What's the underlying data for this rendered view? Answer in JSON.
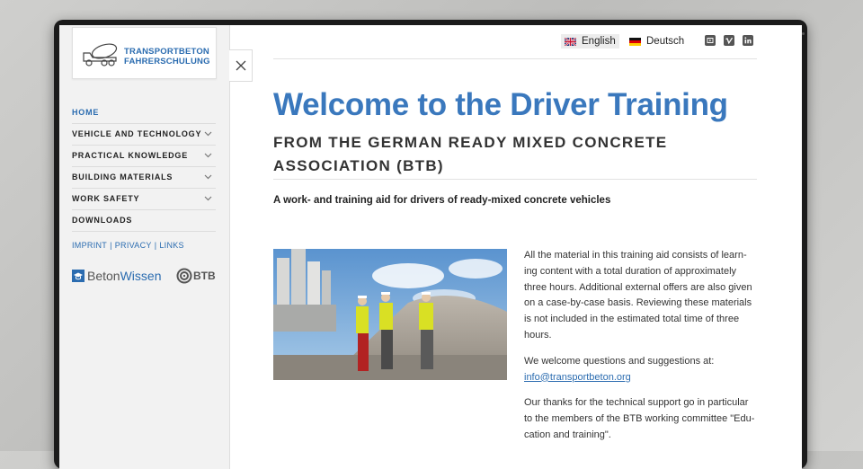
{
  "brand": {
    "line1": "TRANSPORTBETON",
    "line2": "FAHRERSCHULUNG",
    "accent": "#2b6cb0",
    "title_color": "#3a78bd"
  },
  "sidebar": {
    "items": [
      {
        "label": "HOME",
        "active": true,
        "has_submenu": false
      },
      {
        "label": "VEHICLE AND TECHNOLOGY",
        "active": false,
        "has_submenu": true
      },
      {
        "label": "PRACTICAL KNOWLEDGE",
        "active": false,
        "has_submenu": true
      },
      {
        "label": "BUILDING MATERIALS",
        "active": false,
        "has_submenu": true
      },
      {
        "label": "WORK SAFETY",
        "active": false,
        "has_submenu": true
      },
      {
        "label": "DOWNLOADS",
        "active": false,
        "has_submenu": false
      }
    ],
    "links": [
      "IMPRINT",
      "PRIVACY",
      "LINKS"
    ],
    "partners": {
      "betonwissen_a": "Beton",
      "betonwissen_b": "Wissen",
      "btb": "BTB"
    }
  },
  "topbar": {
    "languages": [
      {
        "label": "English",
        "flag": "uk-flag-icon",
        "selected": true
      },
      {
        "label": "Deutsch",
        "flag": "germany-flag-icon",
        "selected": false
      }
    ],
    "social_icons": [
      "youtube-icon",
      "vimeo-icon",
      "linkedin-icon"
    ]
  },
  "main": {
    "title": "Welcome to the Driver Training",
    "subtitle": "FROM THE GERMAN READY MIXED CONCRETE ASSOCIATION (BTB)",
    "tagline": "A work- and training aid for drivers of ready-mixed concrete vehicles",
    "paragraph1": "All the material in this training aid consists of learn-ing content with a total duration of approximately three hours. Additional external offers are also given on a case-by-case basis. Reviewing these materials is not included in the estimated total time of three hours.",
    "paragraph2": "We welcome questions and suggestions at:",
    "email": "info@transportbeton.org",
    "paragraph3": "Our thanks for the technical support go in particular to the members of the BTB working committee \"Edu-cation and training\"."
  }
}
